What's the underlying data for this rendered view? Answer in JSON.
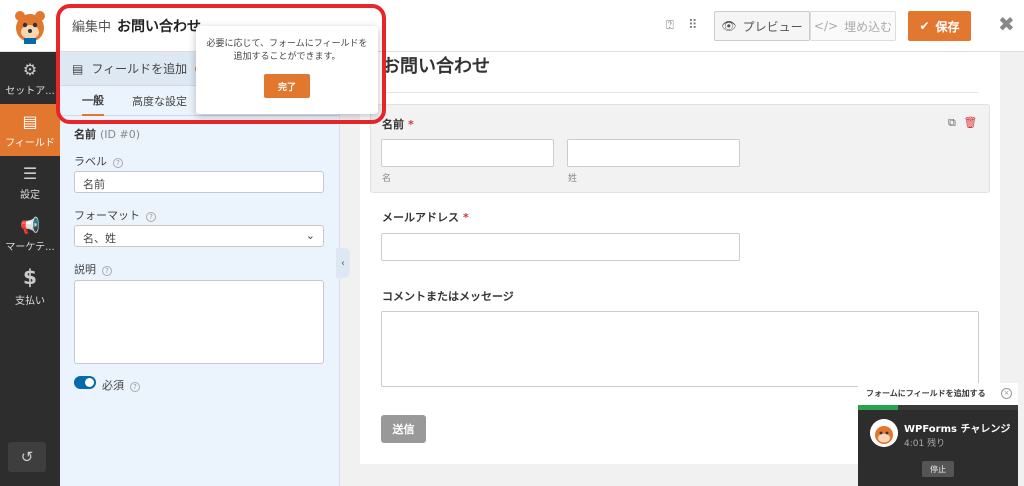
{
  "header": {
    "editing_label": "編集中",
    "form_name": "お問い合わせ",
    "preview_label": "プレビュー",
    "embed_label": "埋め込む",
    "save_label": "保存",
    "help_icon": "help-icon",
    "grid_icon": "grid-icon"
  },
  "sidebar": {
    "items": [
      {
        "label": "セットア...",
        "icon": "gear-icon"
      },
      {
        "label": "フィールド",
        "icon": "fields-icon"
      },
      {
        "label": "設定",
        "icon": "sliders-icon"
      },
      {
        "label": "マーケテ...",
        "icon": "megaphone-icon"
      },
      {
        "label": "支払い",
        "icon": "dollar-icon"
      }
    ]
  },
  "panel": {
    "add_fields_label": "フィールドを追加",
    "tabs": [
      "一般",
      "高度な設定"
    ],
    "field_name": "名前",
    "field_id": "(ID #0)",
    "label_caption": "ラベル",
    "label_value": "名前",
    "format_caption": "フォーマット",
    "format_value": "名、姓",
    "description_caption": "説明",
    "required_label": "必須"
  },
  "form": {
    "title": "お問い合わせ",
    "name_label": "名前",
    "first_sub": "名",
    "last_sub": "姓",
    "email_label": "メールアドレス",
    "comment_label": "コメントまたはメッセージ",
    "submit_label": "送信",
    "required_mark": "*"
  },
  "tooltip": {
    "text": "必要に応じて、フォームにフィールドを追加することができます。",
    "done_label": "完了"
  },
  "challenge": {
    "header": "フォームにフィールドを追加する",
    "name": "WPForms チャレンジ",
    "time": "4:01 残り",
    "stop_label": "停止",
    "progress": 0.25
  },
  "colors": {
    "accent": "#e27730",
    "highlight": "#e8262a",
    "toggle": "#036aab"
  }
}
